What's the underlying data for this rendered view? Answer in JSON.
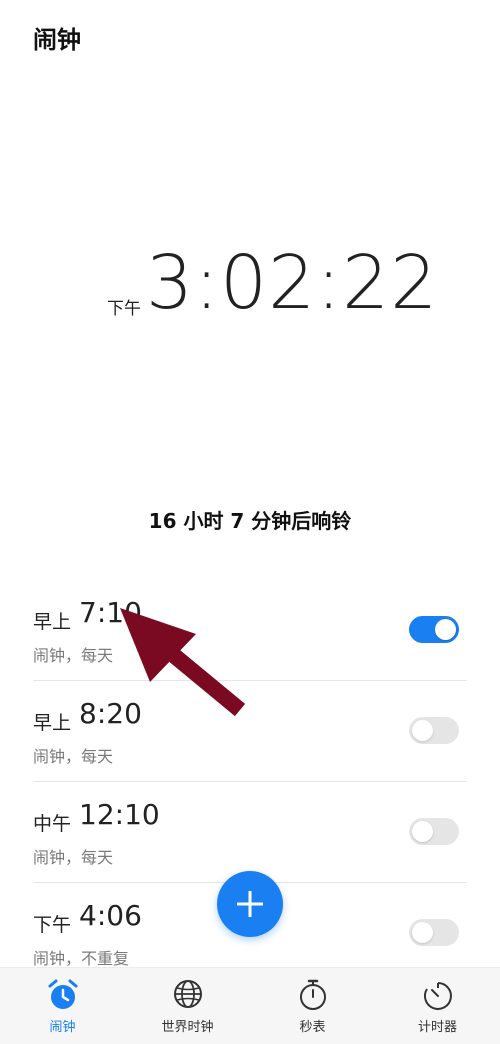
{
  "app": {
    "title": "闹钟"
  },
  "clock": {
    "ampm": "下午",
    "time": "3:02:22"
  },
  "countdown": "16 小时 7 分钟后响铃",
  "alarms": [
    {
      "prefix": "早上",
      "time": "7:10",
      "label": "闹钟，每天",
      "enabled": true
    },
    {
      "prefix": "早上",
      "time": "8:20",
      "label": "闹钟，每天",
      "enabled": false
    },
    {
      "prefix": "中午",
      "time": "12:10",
      "label": "闹钟，每天",
      "enabled": false
    },
    {
      "prefix": "下午",
      "time": "4:06",
      "label": "闹钟，不重复",
      "enabled": false
    }
  ],
  "fab": {
    "icon": "plus-icon"
  },
  "nav": [
    {
      "label": "闹钟",
      "icon": "alarm-clock-icon",
      "active": true
    },
    {
      "label": "世界时钟",
      "icon": "globe-icon",
      "active": false
    },
    {
      "label": "秒表",
      "icon": "stopwatch-icon",
      "active": false
    },
    {
      "label": "计时器",
      "icon": "timer-icon",
      "active": false
    }
  ],
  "colors": {
    "accent": "#1a7ff0",
    "annotation_arrow": "#7a0a22"
  }
}
